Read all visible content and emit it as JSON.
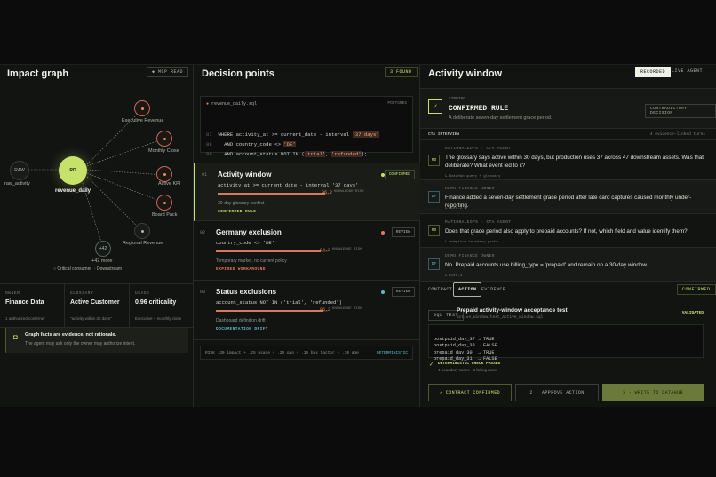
{
  "impact": {
    "title": "Impact graph",
    "tag": "MCP READ",
    "nodes": {
      "raw": {
        "badge": "RAW",
        "label": "raw_activity"
      },
      "rd": {
        "badge": "RD",
        "label": "revenue_daily"
      },
      "exec": {
        "label": "Executive Revenue"
      },
      "monthly": {
        "label": "Monthly Close"
      },
      "kpi": {
        "label": "Active KPI"
      },
      "board": {
        "label": "Board Pack"
      },
      "regional": {
        "label": "Regional Revenue"
      },
      "more": {
        "badge": "+42",
        "label": "+42 more"
      }
    },
    "legend": {
      "critical": "Critical consumer",
      "downstream": "Downstream"
    },
    "meta": [
      {
        "k": "OWNER",
        "v": "Finance Data",
        "s": "1 authorized confirmer"
      },
      {
        "k": "GLOSSARY",
        "v": "Active Customer",
        "s": "\"activity within 30 days\""
      },
      {
        "k": "USAGE",
        "v": "0.96 criticality",
        "s": "Executive + monthly close"
      }
    ],
    "note_title": "Graph facts are evidence, not rationale.",
    "note_body": "The agent may ask only the owner may authorize intent."
  },
  "decisions": {
    "title": "Decision points",
    "found": "3 FOUND",
    "file": "revenue_daily.sql",
    "engine": "POSTGRES",
    "lines": [
      {
        "n": "87",
        "pre": "WHERE activity_at >= current_date - interval ",
        "hl": "'37 days'",
        "post": ""
      },
      {
        "n": "88",
        "pre": "  AND country_code <> ",
        "hl": "'DE'",
        "post": ""
      },
      {
        "n": "89",
        "pre": "  AND account_status NOT IN (",
        "hl": "'trial'",
        "mid": ", ",
        "hl2": "'refunded'",
        "post": ");"
      }
    ],
    "cards": [
      {
        "num": "01",
        "title": "Activity window",
        "code": "activity_at >= current_date - interval '37 days'",
        "pct": "96.2",
        "pk": "KNOWLEDGE RISK",
        "fill": 0.96,
        "note": "30-day glossary conflict",
        "label": "CONFIRMED RULE",
        "status": "CONFIRMED",
        "label_color": "#c6e26b",
        "dot": "#c6e26b"
      },
      {
        "num": "02",
        "title": "Germany exclusion",
        "code": "country_code <> 'DE'",
        "pct": "94.2",
        "pk": "KNOWLEDGE RISK",
        "fill": 0.94,
        "note": "Temporary marker, no current policy",
        "label": "EXPIRED WORKAROUND",
        "status": "REVIEW",
        "label_color": "#e3785e",
        "dot": "#e3785e"
      },
      {
        "num": "03",
        "title": "Status exclusions",
        "code": "account_status NOT IN ('trial', 'refunded')",
        "pct": "96.2",
        "pk": "KNOWLEDGE RISK",
        "fill": 0.96,
        "note": "Dashboard definition drift",
        "label": "DOCUMENTATION DRIFT",
        "status": "REVIEW",
        "label_color": "#5fb6c9",
        "dot": "#5fb6c9"
      }
    ],
    "formula": "RISK  .30 impact + .25 usage + .20 gap + .15 bus factor + .10 age",
    "formula_tag": "DETERMINISTIC"
  },
  "activity": {
    "title": "Activity window",
    "tabs": [
      "RECORDED",
      "LIVE AGENT"
    ],
    "finding_k": "FINDING",
    "finding_v": "CONFIRMED RULE",
    "finding_s": "A deliberate seven-day settlement grace period.",
    "finding_btn": "CONTRADICTORY DECISION",
    "interview": "CTA INTERVIEW",
    "turns": "4 evidence-linked turns",
    "messages": [
      {
        "av": "RD",
        "who": "RATIONALEOPS · CTA AGENT",
        "msg": "The glossary says active within 30 days, but production uses 37 across 47 downstream assets. Was that deliberate? What event led to it?",
        "foot": "↳ DataHub query + glossary"
      },
      {
        "av": "DF",
        "who": "DEMO FINANCE OWNER",
        "msg": "Finance added a seven-day settlement grace period after late card captures caused monthly under-reporting.",
        "foot": "↳ turn-2"
      },
      {
        "av": "RD",
        "who": "RATIONALEOPS · CTA AGENT",
        "msg": "Does that grace period also apply to prepaid accounts? If not, which field and value identify them?",
        "foot": "↳ adaptive boundary probe"
      },
      {
        "av": "DF",
        "who": "DEMO FINANCE OWNER",
        "msg": "No. Prepaid accounts use billing_type = 'prepaid' and remain on a 30-day window.",
        "foot": "↳ turn-4"
      }
    ],
    "subtabs": [
      "CONTRACT",
      "ACTION",
      "EVIDENCE"
    ],
    "confirmed": "CONFIRMED",
    "sql_tag": "SQL TEST",
    "test_title": "Prepaid activity-window acceptance test",
    "test_file": "active_window/test_active_window.sql",
    "validated": "VALIDATED",
    "results": [
      "postpaid_day_37 → TRUE",
      "postpaid_day_38 → FALSE",
      "prepaid_day_30  → TRUE",
      "prepaid_day_31  → FALSE"
    ],
    "check": "DETERMINISTIC CHECK PASSED",
    "check_s": "4 boundary cases · 0 failing rows",
    "buttons": [
      "✓ CONTRACT CONFIRMED",
      "2 · APPROVE ACTION",
      "3 · WRITE TO DATAHUB"
    ]
  },
  "colors": {
    "accent": "#c6e26b",
    "risk": "#d5785f",
    "teal": "#5fb6c9"
  }
}
